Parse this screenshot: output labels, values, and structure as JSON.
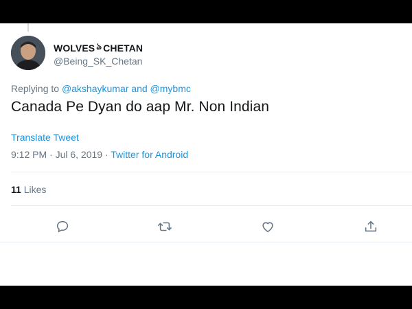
{
  "author": {
    "name_part1": "WOLVES",
    "name_glyph": "ঌ",
    "name_part2": "CHETAN",
    "handle": "@Being_SK_Chetan"
  },
  "replying": {
    "prefix": "Replying to",
    "mention1": "@akshaykumar",
    "conjunction": "and",
    "mention2": "@mybmc"
  },
  "tweet": {
    "text": "Canada Pe Dyan do aap Mr. Non Indian",
    "translate_label": "Translate Tweet",
    "timestamp": "9:12 PM · Jul 6, 2019 ·",
    "source": "Twitter for Android"
  },
  "stats": {
    "likes_count": "11",
    "likes_label": "Likes"
  },
  "actions": {
    "reply_icon": "reply-icon",
    "retweet_icon": "retweet-icon",
    "like_icon": "heart-icon",
    "share_icon": "share-icon"
  },
  "colors": {
    "link": "#1b95e0",
    "muted": "#657786",
    "text": "#14171a",
    "divider": "#e6ecf0"
  }
}
